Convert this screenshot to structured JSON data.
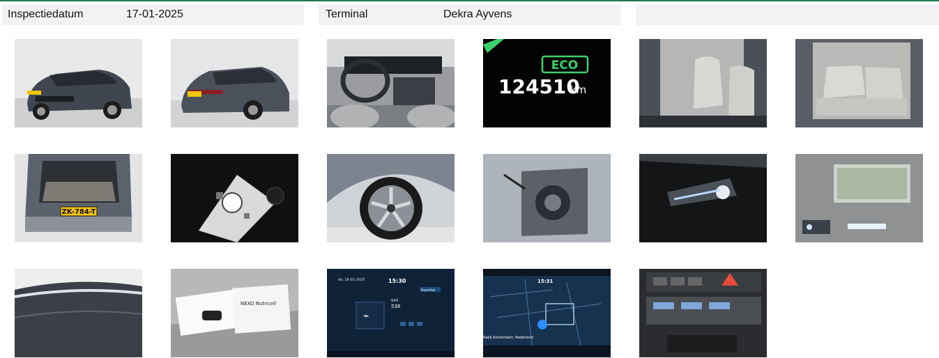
{
  "header": {
    "inspection_date_label": "Inspectiedatum",
    "inspection_date_value": "17-01-2025",
    "terminal_label": "Terminal",
    "terminal_value": "Dekra Ayvens"
  },
  "photos": {
    "odometer": {
      "mode": "ECO",
      "value": "124510",
      "unit": "km"
    },
    "rear_plate": "ZK-784-T",
    "nav_screen_1": {
      "date": "do, 16-01-2025",
      "time": "15:30",
      "tab": "Powerflow",
      "value_label": "BAR",
      "value": "538"
    },
    "nav_screen_2": {
      "time": "15:31",
      "location": "Rabij Amsterdam, Nederland"
    },
    "manual_title": "NEXO Nutricell"
  },
  "colors": {
    "accent_line": "#1f7a4d",
    "header_bg": "#f2f2f2",
    "eco_green": "#3ad16b"
  }
}
